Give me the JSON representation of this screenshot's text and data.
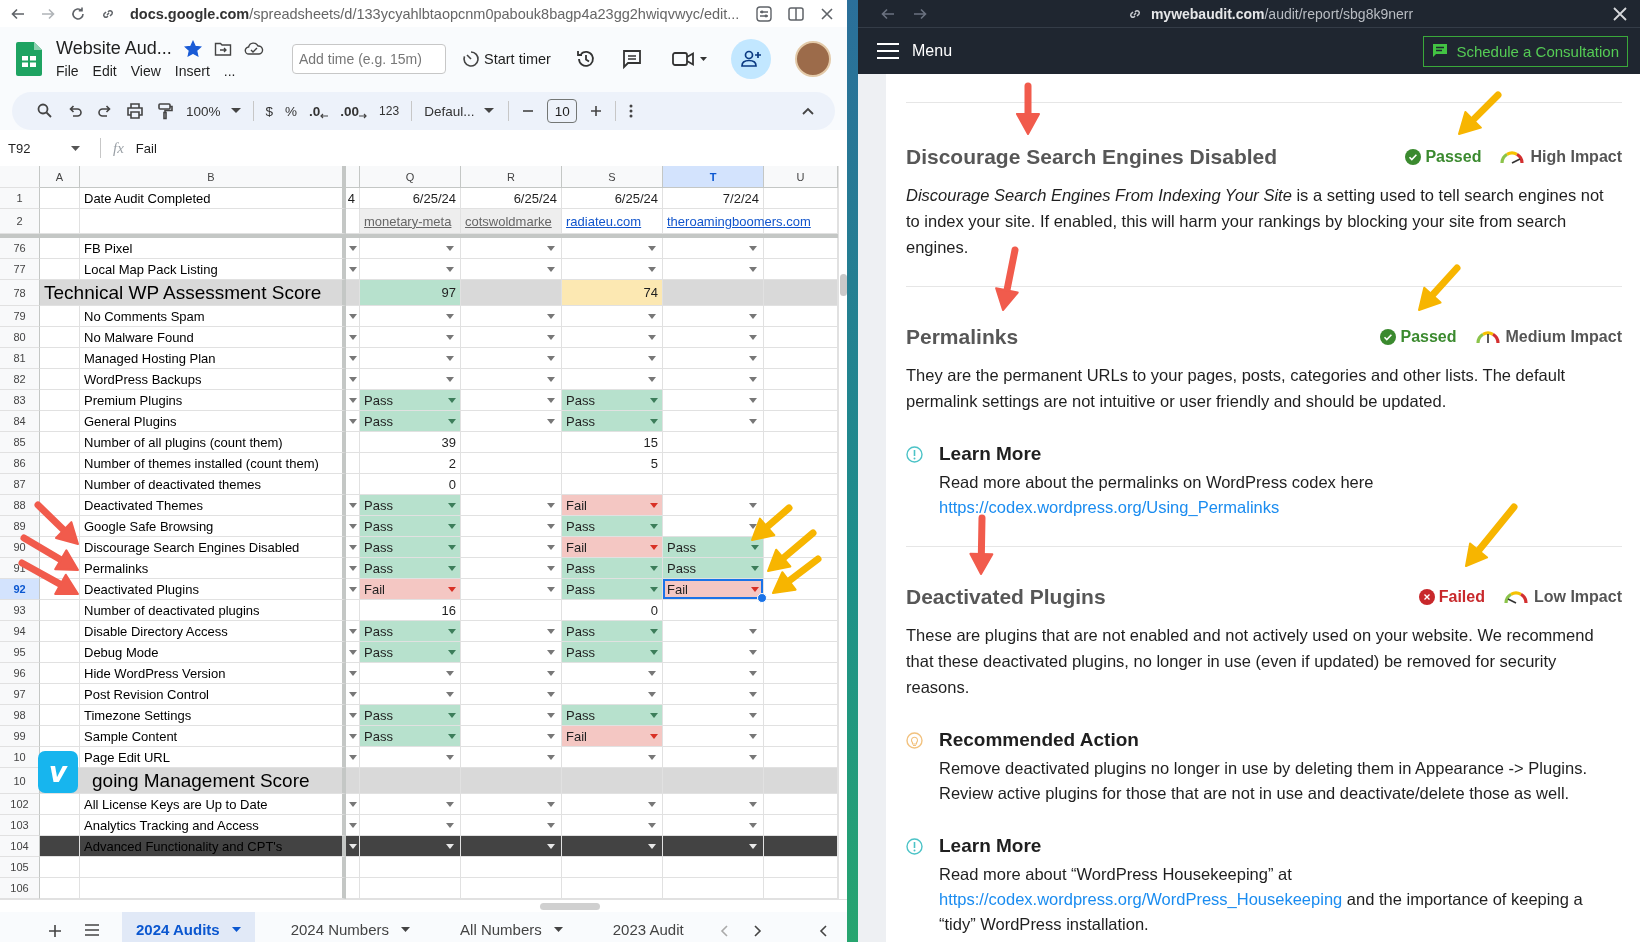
{
  "sheets_browser": {
    "url_host": "docs.google.com",
    "url_path": "/spreadsheets/d/133ycyahlbtaopcnm0pabouk8bagp4a23gg2hwiqvwyc/edit..."
  },
  "sheets_header": {
    "title": "Website Aud...",
    "starred": true,
    "menus": [
      "File",
      "Edit",
      "View",
      "Insert",
      "..."
    ],
    "timer_placeholder": "Add time (e.g. 15m)",
    "timer_button": "Start timer"
  },
  "toolbar": {
    "zoom": "100%",
    "currency": "$",
    "percent": "%",
    "decrease_decimal": ".0",
    "increase_decimal": ".00",
    "number_format": "123",
    "font": "Defaul...",
    "font_size": "10"
  },
  "formula_bar": {
    "cell": "T92",
    "fx": "fx",
    "value": "Fail"
  },
  "sheet": {
    "columns": [
      {
        "label": "A",
        "selected": false
      },
      {
        "label": "B",
        "selected": false
      },
      {
        "selected": false
      },
      {
        "label": "Q",
        "selected": false
      },
      {
        "label": "R",
        "selected": false
      },
      {
        "label": "S",
        "selected": false
      },
      {
        "label": "T",
        "selected": true
      },
      {
        "label": "U",
        "selected": false
      }
    ],
    "rows": [
      {
        "number": "1",
        "kind": "item",
        "selected": false,
        "label": "Date Audit Completed",
        "cells": [
          {
            "kind": "number",
            "text": "4"
          },
          {
            "kind": "number",
            "text": "6/25/24"
          },
          {
            "kind": "number",
            "text": "6/25/24"
          },
          {
            "kind": "number",
            "text": "6/25/24"
          },
          {
            "kind": "number",
            "text": "7/2/24"
          },
          null
        ]
      },
      {
        "number": "2",
        "kind": "item",
        "selected": false,
        "cells": [
          null,
          {
            "kind": "link",
            "text": "monetary-meta",
            "dimmed": true
          },
          {
            "kind": "link",
            "text": "cotswoldmarke",
            "dimmed": true
          },
          {
            "kind": "link",
            "text": "radiateu.com",
            "dimmed": false
          },
          {
            "kind": "link",
            "text": "theroamingboomers.com",
            "dimmed": false
          },
          null
        ]
      },
      {
        "number": "76",
        "kind": "item",
        "selected": false,
        "label": "FB Pixel",
        "cells": [
          {
            "kind": "dropdown"
          },
          {
            "kind": "dropdown"
          },
          {
            "kind": "dropdown"
          },
          {
            "kind": "dropdown"
          },
          {
            "kind": "dropdown"
          },
          null
        ]
      },
      {
        "number": "77",
        "kind": "item",
        "selected": false,
        "label": "Local Map Pack Listing",
        "cells": [
          {
            "kind": "dropdown"
          },
          {
            "kind": "dropdown"
          },
          {
            "kind": "dropdown"
          },
          {
            "kind": "dropdown"
          },
          {
            "kind": "dropdown"
          },
          null
        ]
      },
      {
        "number": "78",
        "kind": "section",
        "selected": false,
        "label": "Technical WP Assessment Score",
        "cells": [
          null,
          {
            "kind": "number",
            "text": "97",
            "color": "#b7e1cd"
          },
          null,
          {
            "kind": "number",
            "text": "74",
            "color": "#fce8b2"
          },
          null,
          null
        ]
      },
      {
        "number": "79",
        "kind": "item",
        "selected": false,
        "label": "No Comments Spam",
        "cells": [
          {
            "kind": "dropdown"
          },
          {
            "kind": "dropdown"
          },
          {
            "kind": "dropdown"
          },
          {
            "kind": "dropdown"
          },
          {
            "kind": "dropdown"
          },
          null
        ]
      },
      {
        "number": "80",
        "kind": "item",
        "selected": false,
        "label": "No Malware Found",
        "cells": [
          {
            "kind": "dropdown"
          },
          {
            "kind": "dropdown"
          },
          {
            "kind": "dropdown"
          },
          {
            "kind": "dropdown"
          },
          {
            "kind": "dropdown"
          },
          null
        ]
      },
      {
        "number": "81",
        "kind": "item",
        "selected": false,
        "label": "Managed Hosting Plan",
        "cells": [
          {
            "kind": "dropdown"
          },
          {
            "kind": "dropdown"
          },
          {
            "kind": "dropdown"
          },
          {
            "kind": "dropdown"
          },
          {
            "kind": "dropdown"
          },
          null
        ]
      },
      {
        "number": "82",
        "kind": "item",
        "selected": false,
        "label": "WordPress Backups",
        "cells": [
          {
            "kind": "dropdown"
          },
          {
            "kind": "dropdown"
          },
          {
            "kind": "dropdown"
          },
          {
            "kind": "dropdown"
          },
          {
            "kind": "dropdown"
          },
          null
        ]
      },
      {
        "number": "83",
        "kind": "item",
        "selected": false,
        "label": "Premium Plugins",
        "cells": [
          {
            "kind": "dropdown"
          },
          {
            "kind": "dropdown",
            "text": "Pass",
            "color": "#b7e1cd"
          },
          {
            "kind": "dropdown"
          },
          {
            "kind": "dropdown",
            "text": "Pass",
            "color": "#b7e1cd"
          },
          {
            "kind": "dropdown"
          },
          null
        ]
      },
      {
        "number": "84",
        "kind": "item",
        "selected": false,
        "label": "General Plugins",
        "cells": [
          {
            "kind": "dropdown"
          },
          {
            "kind": "dropdown",
            "text": "Pass",
            "color": "#b7e1cd"
          },
          {
            "kind": "dropdown"
          },
          {
            "kind": "dropdown",
            "text": "Pass",
            "color": "#b7e1cd"
          },
          {
            "kind": "dropdown"
          },
          null
        ]
      },
      {
        "number": "85",
        "kind": "item",
        "selected": false,
        "label": "Number of all plugins (count them)",
        "cells": [
          null,
          {
            "kind": "number",
            "text": "39"
          },
          null,
          {
            "kind": "number",
            "text": "15"
          },
          null,
          null
        ]
      },
      {
        "number": "86",
        "kind": "item",
        "selected": false,
        "label": "Number of themes installed (count them)",
        "cells": [
          null,
          {
            "kind": "number",
            "text": "2"
          },
          null,
          {
            "kind": "number",
            "text": "5"
          },
          null,
          null
        ]
      },
      {
        "number": "87",
        "kind": "item",
        "selected": false,
        "label": "Number of deactivated themes",
        "cells": [
          null,
          {
            "kind": "number",
            "text": "0"
          },
          null,
          null,
          null,
          null
        ]
      },
      {
        "number": "88",
        "kind": "item",
        "selected": false,
        "label": "Deactivated Themes",
        "cells": [
          {
            "kind": "dropdown"
          },
          {
            "kind": "dropdown",
            "text": "Pass",
            "color": "#b7e1cd"
          },
          {
            "kind": "dropdown"
          },
          {
            "kind": "dropdown",
            "text": "Fail",
            "color": "#f4c7c3"
          },
          {
            "kind": "dropdown"
          },
          null
        ]
      },
      {
        "number": "89",
        "kind": "item",
        "selected": false,
        "label": "Google Safe Browsing",
        "cells": [
          {
            "kind": "dropdown"
          },
          {
            "kind": "dropdown",
            "text": "Pass",
            "color": "#b7e1cd"
          },
          {
            "kind": "dropdown"
          },
          {
            "kind": "dropdown",
            "text": "Pass",
            "color": "#b7e1cd"
          },
          {
            "kind": "dropdown"
          },
          null
        ]
      },
      {
        "number": "90",
        "kind": "item",
        "selected": false,
        "label": "Discourage Search Engines Disabled",
        "cells": [
          {
            "kind": "dropdown"
          },
          {
            "kind": "dropdown",
            "text": "Pass",
            "color": "#b7e1cd"
          },
          {
            "kind": "dropdown"
          },
          {
            "kind": "dropdown",
            "text": "Fail",
            "color": "#f4c7c3"
          },
          {
            "kind": "dropdown",
            "text": "Pass",
            "color": "#b7e1cd"
          },
          null
        ]
      },
      {
        "number": "91",
        "kind": "item",
        "selected": false,
        "label": "Permalinks",
        "cells": [
          {
            "kind": "dropdown"
          },
          {
            "kind": "dropdown",
            "text": "Pass",
            "color": "#b7e1cd"
          },
          {
            "kind": "dropdown"
          },
          {
            "kind": "dropdown",
            "text": "Pass",
            "color": "#b7e1cd"
          },
          {
            "kind": "dropdown",
            "text": "Pass",
            "color": "#b7e1cd"
          },
          null
        ]
      },
      {
        "number": "92",
        "kind": "item",
        "selected": true,
        "label": "Deactivated Plugins",
        "cells": [
          {
            "kind": "dropdown"
          },
          {
            "kind": "dropdown",
            "text": "Fail",
            "color": "#f4c7c3"
          },
          {
            "kind": "dropdown"
          },
          {
            "kind": "dropdown",
            "text": "Pass",
            "color": "#b7e1cd"
          },
          {
            "kind": "dropdown",
            "text": "Fail",
            "color": "#f4c7c3"
          },
          null
        ]
      },
      {
        "number": "93",
        "kind": "item",
        "selected": false,
        "label": "Number of deactivated plugins",
        "cells": [
          null,
          {
            "kind": "number",
            "text": "16"
          },
          null,
          {
            "kind": "number",
            "text": "0"
          },
          null,
          null
        ]
      },
      {
        "number": "94",
        "kind": "item",
        "selected": false,
        "label": "Disable Directory Access",
        "cells": [
          {
            "kind": "dropdown"
          },
          {
            "kind": "dropdown",
            "text": "Pass",
            "color": "#b7e1cd"
          },
          {
            "kind": "dropdown"
          },
          {
            "kind": "dropdown",
            "text": "Pass",
            "color": "#b7e1cd"
          },
          {
            "kind": "dropdown"
          },
          null
        ]
      },
      {
        "number": "95",
        "kind": "item",
        "selected": false,
        "label": "Debug Mode",
        "cells": [
          {
            "kind": "dropdown"
          },
          {
            "kind": "dropdown",
            "text": "Pass",
            "color": "#b7e1cd"
          },
          {
            "kind": "dropdown"
          },
          {
            "kind": "dropdown",
            "text": "Pass",
            "color": "#b7e1cd"
          },
          {
            "kind": "dropdown"
          },
          null
        ]
      },
      {
        "number": "96",
        "kind": "item",
        "selected": false,
        "label": "Hide WordPress Version",
        "cells": [
          {
            "kind": "dropdown"
          },
          {
            "kind": "dropdown"
          },
          {
            "kind": "dropdown"
          },
          {
            "kind": "dropdown"
          },
          {
            "kind": "dropdown"
          },
          null
        ]
      },
      {
        "number": "97",
        "kind": "item",
        "selected": false,
        "label": "Post Revision Control",
        "cells": [
          {
            "kind": "dropdown"
          },
          {
            "kind": "dropdown"
          },
          {
            "kind": "dropdown"
          },
          {
            "kind": "dropdown"
          },
          {
            "kind": "dropdown"
          },
          null
        ]
      },
      {
        "number": "98",
        "kind": "item",
        "selected": false,
        "label": "Timezone Settings",
        "cells": [
          {
            "kind": "dropdown"
          },
          {
            "kind": "dropdown",
            "text": "Pass",
            "color": "#b7e1cd"
          },
          {
            "kind": "dropdown"
          },
          {
            "kind": "dropdown",
            "text": "Pass",
            "color": "#b7e1cd"
          },
          {
            "kind": "dropdown"
          },
          null
        ]
      },
      {
        "number": "99",
        "kind": "item",
        "selected": false,
        "label": "Sample Content",
        "cells": [
          {
            "kind": "dropdown"
          },
          {
            "kind": "dropdown",
            "text": "Pass",
            "color": "#b7e1cd"
          },
          {
            "kind": "dropdown"
          },
          {
            "kind": "dropdown",
            "text": "Fail",
            "color": "#f4c7c3"
          },
          {
            "kind": "dropdown"
          },
          null
        ]
      },
      {
        "number": "10",
        "kind": "item",
        "selected": false,
        "label": "Page Edit URL",
        "cells": [
          {
            "kind": "dropdown"
          },
          {
            "kind": "dropdown"
          },
          {
            "kind": "dropdown"
          },
          {
            "kind": "dropdown"
          },
          {
            "kind": "dropdown"
          },
          null
        ]
      },
      {
        "number": "10",
        "kind": "section",
        "selected": false,
        "label": "going Management Score",
        "badge": "v",
        "cells": [
          null,
          null,
          null,
          null,
          null,
          null
        ]
      },
      {
        "number": "102",
        "kind": "item",
        "selected": false,
        "label": "All License Keys are Up to Date",
        "cells": [
          {
            "kind": "dropdown"
          },
          {
            "kind": "dropdown"
          },
          {
            "kind": "dropdown"
          },
          {
            "kind": "dropdown"
          },
          {
            "kind": "dropdown"
          },
          null
        ]
      },
      {
        "number": "103",
        "kind": "item",
        "selected": false,
        "label": "Analytics Tracking and Access",
        "cells": [
          {
            "kind": "dropdown"
          },
          {
            "kind": "dropdown"
          },
          {
            "kind": "dropdown"
          },
          {
            "kind": "dropdown"
          },
          {
            "kind": "dropdown"
          },
          null
        ]
      },
      {
        "number": "104",
        "kind": "dark",
        "selected": false,
        "label": "Advanced Functionality and CPT's",
        "cells": [
          {
            "kind": "dropdown"
          },
          {
            "kind": "dropdown"
          },
          {
            "kind": "dropdown"
          },
          {
            "kind": "dropdown"
          },
          {
            "kind": "dropdown"
          },
          null
        ]
      },
      {
        "number": "105",
        "kind": "item",
        "selected": false,
        "cells": [
          null,
          null,
          null,
          null,
          null,
          null
        ]
      },
      {
        "number": "106",
        "kind": "item",
        "selected": false,
        "cells": [
          null,
          null,
          null,
          null,
          null,
          null
        ]
      }
    ]
  },
  "sheet_tabs": [
    {
      "label": "2024 Audits",
      "selected": true
    },
    {
      "label": "2024 Numbers",
      "selected": false
    },
    {
      "label": "All Numbers",
      "selected": false
    },
    {
      "label": "2023 Audit",
      "selected": false
    }
  ],
  "report_browser": {
    "url_host": "mywebaudit.com",
    "url_path": "/audit/report/sbg8k9nerr"
  },
  "report_nav": {
    "menu": "Menu",
    "cta": "Schedule a Consultation"
  },
  "report_sections": [
    {
      "title": "Discourage Search Engines Disabled",
      "passed": true,
      "status": "Passed",
      "impact": "High Impact",
      "kind": "high",
      "body": "*Discourage Search Engines From Indexing Your Site* is a setting used to tell search engines not to index your site. If enabled, this will harm your rankings by blocking your site from search engines."
    },
    {
      "title": "Permalinks",
      "passed": true,
      "status": "Passed",
      "impact": "Medium Impact",
      "kind": "medium",
      "body": "They are the permanent URLs to your pages, posts, categories and other lists. The default permalink settings are not intuitive or user friendly and should be updated.",
      "notes": [
        {
          "kind": "learn",
          "title": "Learn More",
          "text": "Read more about the permalinks on WordPress codex here",
          "link": "https://codex.wordpress.org/Using_Permalinks"
        }
      ]
    },
    {
      "title": "Deactivated Plugins",
      "passed": false,
      "status": "Failed",
      "impact": "Low Impact",
      "kind": "low",
      "body": "These are plugins that are not enabled and not actively used on your website. We recommend that these deactivated plugins, no longer in use (even if updated) be removed for security reasons.",
      "notes": [
        {
          "kind": "action",
          "title": "Recommended Action",
          "text": "Remove deactivated plugins no longer in use by deleting them in Appearance -> Plugins. Review active plugins for those that are not in use and deactivate/delete those as well."
        },
        {
          "kind": "learn",
          "title": "Learn More",
          "text": "Read more about “WordPress Housekeeping” at",
          "link": "https://codex.wordpress.org/WordPress_Housekeeping",
          "text_after": "and the importance of keeping a “tidy” WordPress installation."
        }
      ]
    }
  ],
  "annotation_arrows": [
    {
      "color": "#f15b4c"
    },
    {
      "color": "#f15b4c"
    },
    {
      "color": "#f15b4c"
    },
    {
      "color": "#f7b500"
    },
    {
      "color": "#f7b500"
    },
    {
      "color": "#f7b500"
    },
    {
      "color": "#f15b4c"
    },
    {
      "color": "#f15b4c"
    },
    {
      "color": "#f15b4c"
    },
    {
      "color": "#f7b500"
    },
    {
      "color": "#f7b500"
    },
    {
      "color": "#f7b500"
    }
  ]
}
